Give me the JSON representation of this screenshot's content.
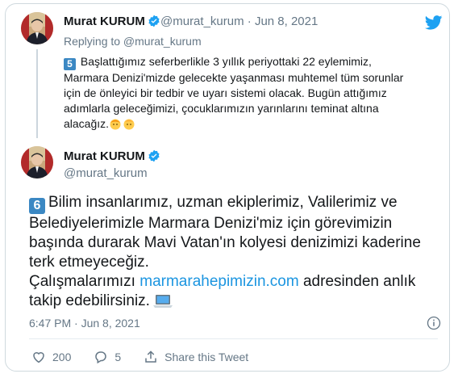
{
  "quoted_tweet": {
    "author_name": "Murat KURUM",
    "author_handle": "@murat_kurum",
    "separator": " · ",
    "date": "Jun 8, 2021",
    "reply_label": "Replying to @murat_kurum",
    "keycap": "5",
    "lines": [
      "Başlattığımız seferberlikle 3 yıllık periyottaki 22 eylemimiz,",
      "Marmara Denizi'mizde gelecekte yaşanması muhtemel tüm sorunlar",
      "için de önleyici bir tedbir ve uyarı sistemi olacak. Bugün attığımız",
      "adımlarla geleceğimizi, çocuklarımızın yarınlarını teminat altına",
      "alacağız."
    ]
  },
  "main_tweet": {
    "author_name": "Murat KURUM",
    "author_handle": "@murat_kurum",
    "keycap": "6",
    "text_lines": [
      "Bilim insanlarımız, uzman ekiplerimiz, Valilerimiz ve",
      "Belediyelerimizle Marmara Denizi'miz için görevimizin",
      "başında durarak Mavi Vatan'ın kolyesi denizimizi kaderine",
      "terk etmeyeceğiz."
    ],
    "line5_prefix": "Çalışmalarımızı ",
    "link_text": "marmarahepimizin.com",
    "line5_suffix": " adresinden anlık",
    "line6": "takip edebilirsiniz.",
    "timestamp": "6:47 PM · Jun 8, 2021"
  },
  "actions": {
    "likes": "200",
    "replies": "5",
    "share_label": "Share this Tweet"
  },
  "icons": {
    "brand": "twitter-bird-icon",
    "verified": "verified-badge-icon",
    "info": "info-icon",
    "like": "heart-icon",
    "reply": "reply-icon",
    "share": "share-icon"
  },
  "colors": {
    "brand_blue": "#1da1f2",
    "link_blue": "#1b95e0",
    "muted": "#657786",
    "keycap_blue": "#3b88c3"
  }
}
